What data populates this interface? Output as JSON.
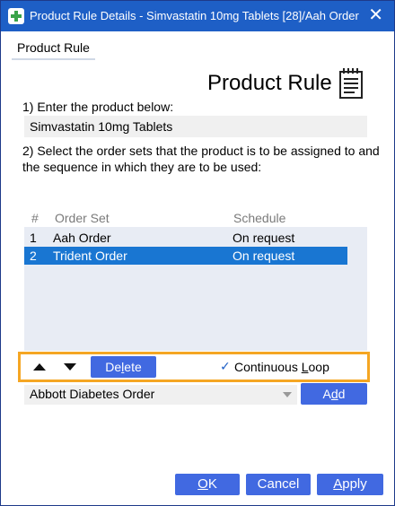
{
  "window": {
    "title": "Product Rule Details - Simvastatin 10mg Tablets [28]/Aah Order",
    "close_glyph": "✕"
  },
  "tab": {
    "label": "Product Rule"
  },
  "heading": "Product Rule",
  "step1": {
    "label": "1) Enter the product below:",
    "product_value": "Simvastatin 10mg Tablets"
  },
  "step2": {
    "label": "2) Select the order sets that the product is to be assigned to and the sequence in which they are to be used:"
  },
  "table": {
    "columns": [
      "#",
      "Order Set",
      "Schedule"
    ],
    "rows": [
      {
        "num": "1",
        "order_set": "Aah Order",
        "schedule": "On request",
        "selected": false
      },
      {
        "num": "2",
        "order_set": "Trident Order",
        "schedule": "On request",
        "selected": true
      }
    ]
  },
  "toolbar": {
    "up_icon": "arrow-up-icon",
    "down_icon": "arrow-down-icon",
    "delete_label_pre": "De",
    "delete_label_mn": "l",
    "delete_label_post": "ete",
    "checkmark_glyph": "✓",
    "continuous_pre": "Continuous ",
    "continuous_mn": "L",
    "continuous_post": "oop"
  },
  "add_row": {
    "dropdown_value": "Abbott Diabetes Order",
    "add_pre": "A",
    "add_mn": "d",
    "add_post": "d"
  },
  "footer": {
    "ok_mn": "O",
    "ok_post": "K",
    "cancel_label": "Cancel",
    "apply_mn": "A",
    "apply_post": "pply"
  },
  "colors": {
    "titlebar": "#1e5fc6",
    "button": "#4169e1",
    "selection": "#1976d2",
    "highlight_border": "#f5a623"
  }
}
